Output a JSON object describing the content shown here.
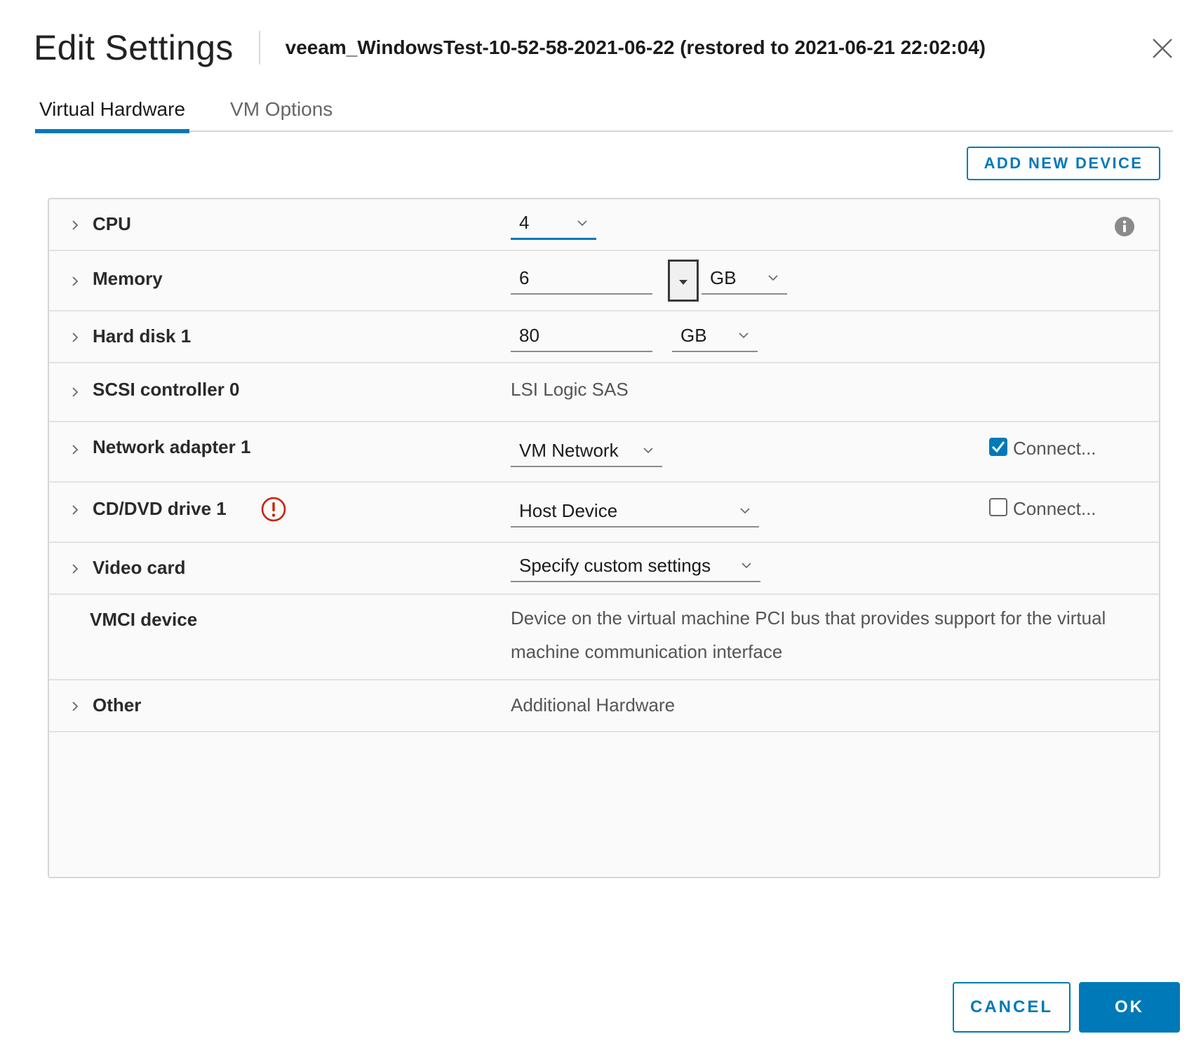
{
  "dialog": {
    "title": "Edit Settings",
    "subtitle": "veeam_WindowsTest-10-52-58-2021-06-22 (restored to 2021-06-21 22:02:04)"
  },
  "tabs": [
    {
      "label": "Virtual Hardware",
      "active": true
    },
    {
      "label": "VM Options",
      "active": false
    }
  ],
  "toolbar": {
    "add_device_label": "ADD NEW DEVICE"
  },
  "hardware": {
    "cpu": {
      "label": "CPU",
      "value": "4"
    },
    "memory": {
      "label": "Memory",
      "value": "6",
      "unit": "GB"
    },
    "hard_disk": {
      "label": "Hard disk 1",
      "value": "80",
      "unit": "GB"
    },
    "scsi": {
      "label": "SCSI controller 0",
      "value": "LSI Logic SAS"
    },
    "network": {
      "label": "Network adapter 1",
      "value": "VM Network",
      "connect_label": "Connect...",
      "connected": true
    },
    "cddvd": {
      "label": "CD/DVD drive 1",
      "value": "Host Device",
      "connect_label": "Connect...",
      "connected": false
    },
    "video": {
      "label": "Video card",
      "value": "Specify custom settings"
    },
    "vmci": {
      "label": "VMCI device",
      "description": "Device on the virtual machine PCI bus that provides support for the virtual machine communication interface"
    },
    "other": {
      "label": "Other",
      "value": "Additional Hardware"
    }
  },
  "footer": {
    "cancel_label": "CANCEL",
    "ok_label": "OK"
  },
  "colors": {
    "accent": "#0079b8",
    "warning": "#c92100"
  }
}
